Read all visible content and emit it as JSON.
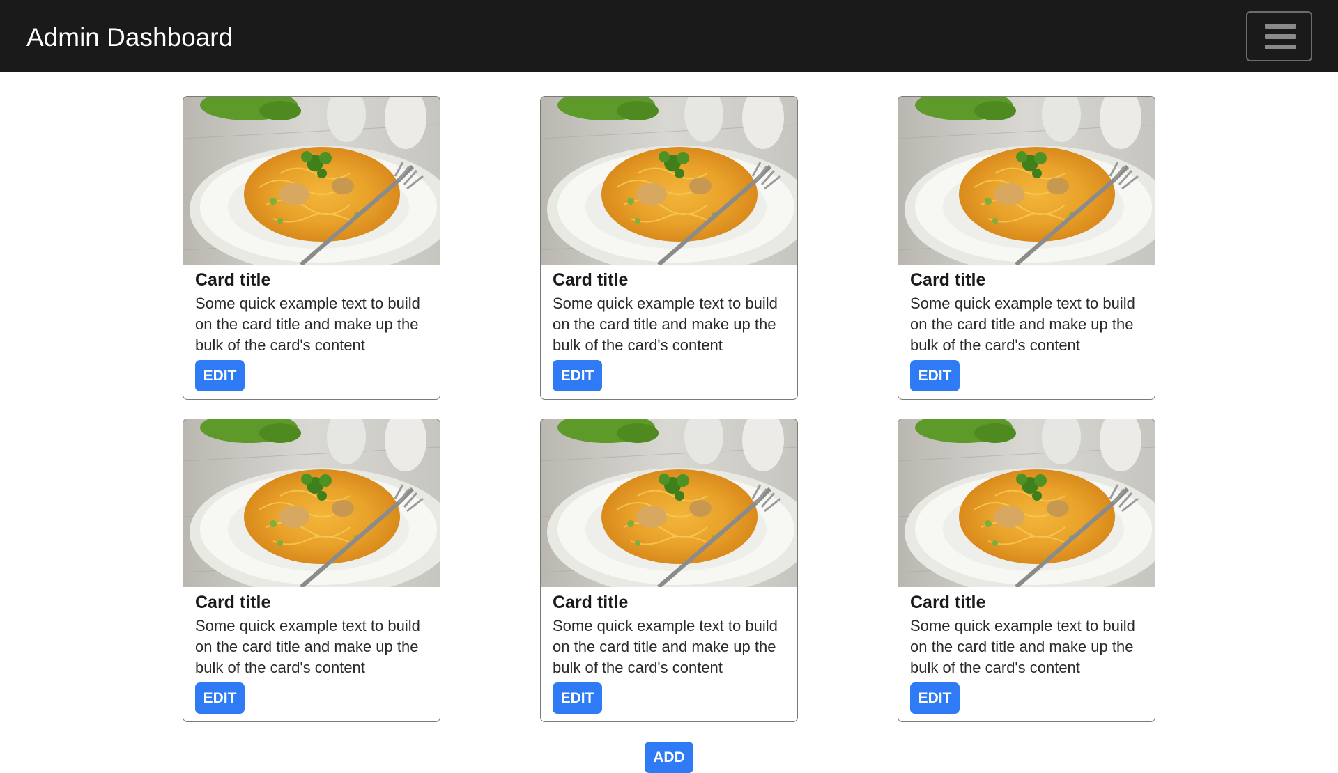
{
  "header": {
    "title": "Admin Dashboard",
    "menu_icon": "hamburger-menu-icon",
    "background": "#1b1a1b"
  },
  "cards": [
    {
      "title": "Card title",
      "text": "Some quick example text to build on the card title and make up the bulk of the card's content",
      "button": "EDIT",
      "image": "pasta-plate-photo"
    },
    {
      "title": "Card title",
      "text": "Some quick example text to build on the card title and make up the bulk of the card's content",
      "button": "EDIT",
      "image": "pasta-plate-photo"
    },
    {
      "title": "Card title",
      "text": "Some quick example text to build on the card title and make up the bulk of the card's content",
      "button": "EDIT",
      "image": "pasta-plate-photo"
    },
    {
      "title": "Card title",
      "text": "Some quick example text to build on the card title and make up the bulk of the card's content",
      "button": "EDIT",
      "image": "pasta-plate-photo"
    },
    {
      "title": "Card title",
      "text": "Some quick example text to build on the card title and make up the bulk of the card's content",
      "button": "EDIT",
      "image": "pasta-plate-photo"
    },
    {
      "title": "Card title",
      "text": "Some quick example text to build on the card title and make up the bulk of the card's content",
      "button": "EDIT",
      "image": "pasta-plate-photo"
    }
  ],
  "add_button": "ADD",
  "colors": {
    "accent": "#2f7bf5",
    "navbar": "#1b1a1b"
  }
}
